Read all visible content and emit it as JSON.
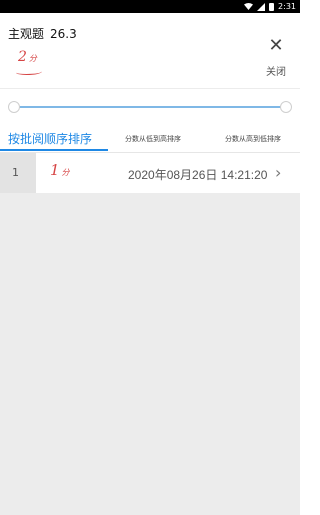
{
  "status_bar": {
    "time": "2:31",
    "icons": [
      "wifi-icon",
      "signal-icon",
      "battery-icon"
    ]
  },
  "header": {
    "title": "主观题",
    "score": "26.3",
    "handwritten_score": "2",
    "handwritten_unit": "分",
    "close_label": "关闭"
  },
  "slider": {
    "value_start": 0,
    "value_end": 1
  },
  "tabs": [
    {
      "label": "按批阅顺序排序",
      "active": true
    },
    {
      "label": "分数从低到高排序",
      "active": false
    },
    {
      "label": "分数从高到低排序",
      "active": false
    }
  ],
  "list": [
    {
      "index": "1",
      "handwritten_score": "1",
      "handwritten_unit": "分",
      "timestamp": "2020年08月26日 14:21:20"
    }
  ],
  "colors": {
    "accent": "#1e88e5",
    "mark_red": "#d64545",
    "list_bg": "#ececec"
  }
}
